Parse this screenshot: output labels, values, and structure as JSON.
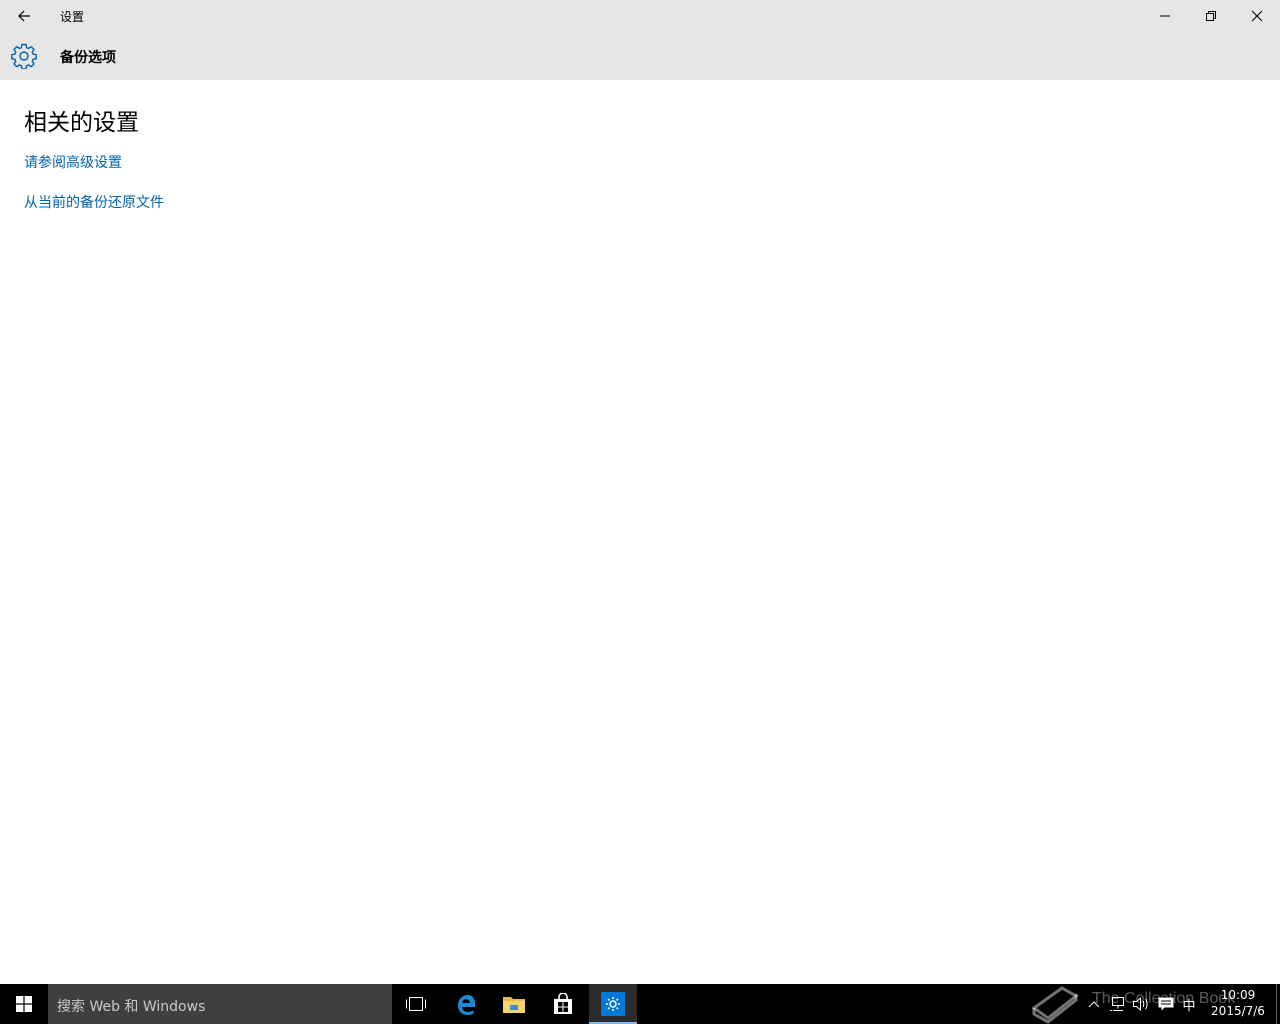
{
  "window": {
    "title": "设置",
    "header_title": "备份选项",
    "icons": {
      "back": "back-arrow-icon",
      "minimize": "minimize-icon",
      "maximize": "restore-icon",
      "close": "close-icon",
      "header": "gear-icon"
    }
  },
  "content": {
    "section_title": "相关的设置",
    "links": [
      {
        "label": "请参阅高级设置"
      },
      {
        "label": "从当前的备份还原文件"
      }
    ],
    "accent_color": "#0063b1"
  },
  "taskbar": {
    "search_placeholder": "搜索 Web 和 Windows",
    "apps": [
      "task-view-icon",
      "edge-icon",
      "file-explorer-icon",
      "store-icon",
      "settings-icon"
    ],
    "active_app": "settings",
    "tray": {
      "ime": "中",
      "time": "10:09",
      "date": "2015/7/6"
    },
    "watermark": "The Collection Book"
  }
}
